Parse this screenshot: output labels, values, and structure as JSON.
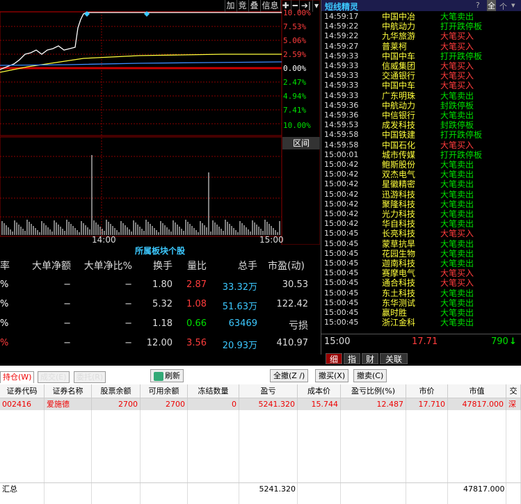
{
  "toolbar": {
    "items": [
      "加",
      "竞",
      "叠",
      "信息",
      "✚",
      "━",
      "➔|",
      "▾"
    ]
  },
  "chart_pct": {
    "up": [
      "10.00%",
      "7.53%",
      "5.06%",
      "2.59%"
    ],
    "zero": "0.00%",
    "down": [
      "2.47%",
      "4.94%",
      "7.41%",
      "10.00%"
    ]
  },
  "chart_times": [
    "14:00",
    "15:00"
  ],
  "qujian": "区间",
  "sector": {
    "title": "所属板块个股",
    "headers": [
      "率",
      "大单净额",
      "大单净比%",
      "换手",
      "量比",
      "总手",
      "市盈(动)"
    ],
    "rows": [
      {
        "a": "%",
        "b": "−",
        "c": "−",
        "d": "1.80",
        "e": "2.87",
        "f": "33.32万",
        "g": "30.53"
      },
      {
        "a": "%",
        "b": "−",
        "c": "−",
        "d": "5.32",
        "e": "1.08",
        "f": "51.63万",
        "g": "122.42"
      },
      {
        "a": "%",
        "b": "−",
        "c": "−",
        "d": "1.18",
        "e": "0.66",
        "f": "63469",
        "g": "亏损"
      },
      {
        "a": "%",
        "b": "−",
        "c": "−",
        "d": "12.00",
        "e": "3.56",
        "f": "20.93万",
        "g": "410.97"
      }
    ]
  },
  "right_panel": {
    "title": "短线精灵",
    "title_icons": [
      "?",
      "全",
      "个",
      "▾"
    ],
    "news": [
      {
        "t": "14:59:17",
        "n": "中国中冶",
        "s": "大笔卖出",
        "c": "green"
      },
      {
        "t": "14:59:22",
        "n": "中航动力",
        "s": "打开跌停板",
        "c": "green"
      },
      {
        "t": "14:59:22",
        "n": "九华旅游",
        "s": "大笔买入",
        "c": "red"
      },
      {
        "t": "14:59:27",
        "n": "普莱柯",
        "s": "大笔买入",
        "c": "red"
      },
      {
        "t": "14:59:33",
        "n": "中国中车",
        "s": "打开跌停板",
        "c": "green"
      },
      {
        "t": "14:59:33",
        "n": "信威集团",
        "s": "大笔买入",
        "c": "red"
      },
      {
        "t": "14:59:33",
        "n": "交通银行",
        "s": "大笔买入",
        "c": "red"
      },
      {
        "t": "14:59:33",
        "n": "中国中车",
        "s": "大笔买入",
        "c": "red"
      },
      {
        "t": "14:59:33",
        "n": "广东明珠",
        "s": "大笔卖出",
        "c": "green"
      },
      {
        "t": "14:59:36",
        "n": "中航动力",
        "s": "封跌停板",
        "c": "green"
      },
      {
        "t": "14:59:36",
        "n": "中信银行",
        "s": "大笔卖出",
        "c": "green"
      },
      {
        "t": "14:59:53",
        "n": "成发科技",
        "s": "封跌停板",
        "c": "green"
      },
      {
        "t": "14:59:58",
        "n": "中国铁建",
        "s": "打开跌停板",
        "c": "green"
      },
      {
        "t": "14:59:58",
        "n": "中国石化",
        "s": "大笔买入",
        "c": "red"
      },
      {
        "t": "15:00:01",
        "n": "城市传媒",
        "s": "打开跌停板",
        "c": "green"
      },
      {
        "t": "15:00:42",
        "n": "鲍斯股份",
        "s": "大笔卖出",
        "c": "green"
      },
      {
        "t": "15:00:42",
        "n": "双杰电气",
        "s": "大笔卖出",
        "c": "green"
      },
      {
        "t": "15:00:42",
        "n": "星徽精密",
        "s": "大笔卖出",
        "c": "green"
      },
      {
        "t": "15:00:42",
        "n": "迅游科技",
        "s": "大笔卖出",
        "c": "green"
      },
      {
        "t": "15:00:42",
        "n": "聚隆科技",
        "s": "大笔卖出",
        "c": "green"
      },
      {
        "t": "15:00:42",
        "n": "光力科技",
        "s": "大笔卖出",
        "c": "green"
      },
      {
        "t": "15:00:42",
        "n": "华自科技",
        "s": "大笔卖出",
        "c": "green"
      },
      {
        "t": "15:00:45",
        "n": "长亮科技",
        "s": "大笔买入",
        "c": "red"
      },
      {
        "t": "15:00:45",
        "n": "蒙草抗旱",
        "s": "大笔卖出",
        "c": "green"
      },
      {
        "t": "15:00:45",
        "n": "花园生物",
        "s": "大笔卖出",
        "c": "green"
      },
      {
        "t": "15:00:45",
        "n": "迦南科技",
        "s": "大笔卖出",
        "c": "green"
      },
      {
        "t": "15:00:45",
        "n": "赛摩电气",
        "s": "大笔买入",
        "c": "red"
      },
      {
        "t": "15:00:45",
        "n": "通合科技",
        "s": "大笔买入",
        "c": "red"
      },
      {
        "t": "15:00:45",
        "n": "东土科技",
        "s": "大笔卖出",
        "c": "green"
      },
      {
        "t": "15:00:45",
        "n": "东华测试",
        "s": "大笔卖出",
        "c": "green"
      },
      {
        "t": "15:00:45",
        "n": "赢时胜",
        "s": "大笔卖出",
        "c": "green"
      },
      {
        "t": "15:00:45",
        "n": "浙江金科",
        "s": "大笔卖出",
        "c": "green"
      }
    ],
    "bottom": {
      "time": "15:00",
      "price": "17.71",
      "vol": "790",
      "arrow": "↓"
    },
    "tabs": [
      "细",
      "指",
      "财",
      "关联"
    ]
  },
  "trade": {
    "tabs": [
      "持仓(W)",
      "成交(E)",
      "委托(R)"
    ],
    "refresh": "刷新",
    "actions": [
      "全撤(Z /)",
      "撤买(X)",
      "撤卖(C)"
    ],
    "columns": [
      "证券代码",
      "证券名称",
      "股票余额",
      "可用余额",
      "冻结数量",
      "盈亏",
      "成本价",
      "盈亏比例(%)",
      "市价",
      "市值",
      "交"
    ],
    "row": [
      "002416",
      "爱施德",
      "2700",
      "2700",
      "0",
      "5241.320",
      "15.744",
      "12.487",
      "17.710",
      "47817.000",
      "深"
    ],
    "summary": {
      "label": "汇总",
      "pl": "5241.320",
      "value": "47817.000"
    }
  }
}
